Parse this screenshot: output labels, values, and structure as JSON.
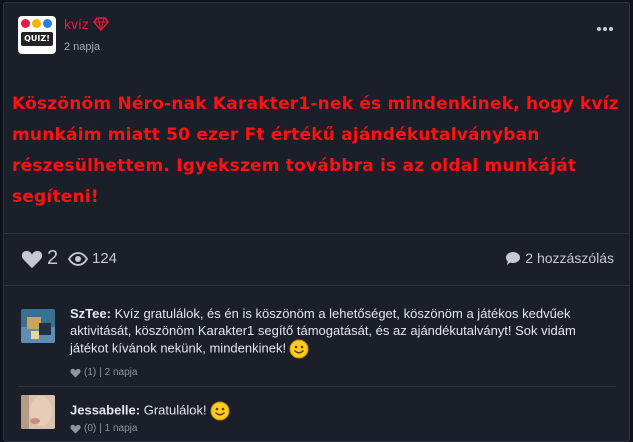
{
  "post": {
    "author": "kvíz",
    "time": "2 napja",
    "avatar_label": "QUIZ!",
    "text": "Köszönöm Néro-nak Karakter1-nek és mindenkinek, hogy kvíz munkáim miatt 50 ezer Ft értékű ajándékutalványban részesülhettem. Igyekszem továbbra is az oldal munkáját segíteni!",
    "likes": "2",
    "views": "124",
    "comments_label": "2 hozzászólás"
  },
  "comments": [
    {
      "name": "SzTee:",
      "text": "Kvíz gratulálok, és én is köszönöm a lehetőséget, köszönöm a játékos kedvűek aktivitását, köszönöm Karakter1 segítő támogatását, és az ajándékutalványt! Sok vidám játékot kívánok nekünk, mindenkinek!",
      "likes": "(1)",
      "time": "| 2 napja"
    },
    {
      "name": "Jessabelle:",
      "text": "Gratulálok!",
      "likes": "(0)",
      "time": "| 1 napja"
    }
  ],
  "colors": {
    "accent": "#e8193a",
    "post_text": "#ff1111",
    "background": "#0f121a",
    "card": "#1b1f2a"
  },
  "icons": [
    "gem-icon",
    "more-icon",
    "heart-icon",
    "eye-icon",
    "comment-icon",
    "smiley-icon"
  ]
}
